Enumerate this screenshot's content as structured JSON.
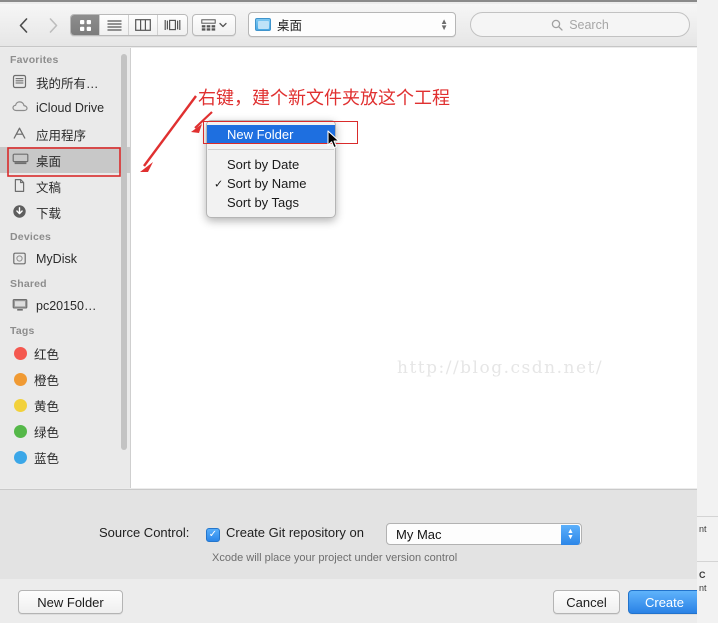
{
  "toolbar": {
    "back_icon": "chevron-left-icon",
    "forward_icon": "chevron-right-icon",
    "view_modes": [
      {
        "name": "icon-view",
        "active": true
      },
      {
        "name": "list-view",
        "active": false
      },
      {
        "name": "column-view",
        "active": false
      },
      {
        "name": "coverflow-view",
        "active": false
      }
    ],
    "arrange_icon": "arrange-icon",
    "location": {
      "label": "桌面",
      "icon": "folder-icon"
    },
    "search": {
      "placeholder": "Search",
      "icon": "search-icon"
    }
  },
  "sidebar": {
    "sections": [
      {
        "title": "Favorites",
        "items": [
          {
            "label": "我的所有…",
            "icon": "all-my-files-icon"
          },
          {
            "label": "iCloud Drive",
            "icon": "cloud-icon"
          },
          {
            "label": "应用程序",
            "icon": "applications-icon"
          },
          {
            "label": "桌面",
            "icon": "desktop-icon",
            "selected": true
          },
          {
            "label": "文稿",
            "icon": "documents-icon"
          },
          {
            "label": "下载",
            "icon": "downloads-icon"
          }
        ]
      },
      {
        "title": "Devices",
        "items": [
          {
            "label": "MyDisk",
            "icon": "disk-icon"
          }
        ]
      },
      {
        "title": "Shared",
        "items": [
          {
            "label": "pc20150…",
            "icon": "computer-icon"
          }
        ]
      },
      {
        "title": "Tags",
        "items": [
          {
            "label": "红色",
            "icon": "tag-dot-icon",
            "color": "#f4584f"
          },
          {
            "label": "橙色",
            "icon": "tag-dot-icon",
            "color": "#f09a33"
          },
          {
            "label": "黄色",
            "icon": "tag-dot-icon",
            "color": "#f2d13b"
          },
          {
            "label": "绿色",
            "icon": "tag-dot-icon",
            "color": "#55b849"
          },
          {
            "label": "蓝色",
            "icon": "tag-dot-icon",
            "color": "#3ba7e8"
          }
        ]
      }
    ]
  },
  "file_pane": {
    "watermark": "http://blog.csdn.net/"
  },
  "annotation": {
    "text": "右键，建个新文件夹放这个工程",
    "color": "#e03030"
  },
  "context_menu": {
    "items": [
      {
        "label": "New Folder",
        "highlighted": true
      },
      {
        "label": "Sort by Date",
        "checked": false
      },
      {
        "label": "Sort by Name",
        "checked": true
      },
      {
        "label": "Sort by Tags",
        "checked": false
      }
    ],
    "check_glyph": "✓"
  },
  "source_control": {
    "label": "Source Control:",
    "checkbox_label": "Create Git repository on",
    "checkbox_checked": true,
    "check_glyph": "✓",
    "select_value": "My Mac",
    "hint": "Xcode will place your project under version control"
  },
  "footer": {
    "new_folder": "New Folder",
    "cancel": "Cancel",
    "create": "Create"
  },
  "background_window": {
    "fragments": [
      "nt",
      "C",
      "nt"
    ]
  }
}
